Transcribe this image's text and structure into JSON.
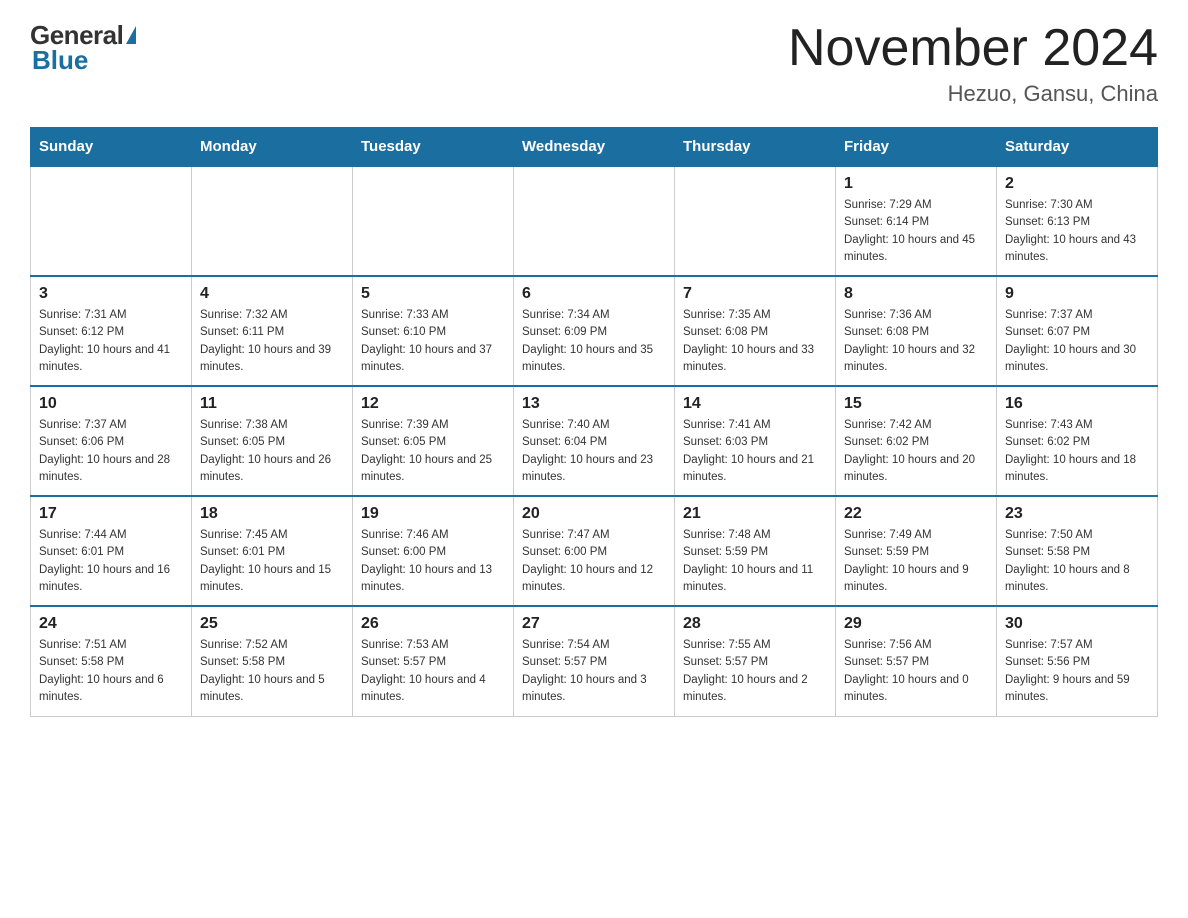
{
  "header": {
    "logo_general": "General",
    "logo_blue": "Blue",
    "month_title": "November 2024",
    "location": "Hezuo, Gansu, China"
  },
  "weekdays": [
    "Sunday",
    "Monday",
    "Tuesday",
    "Wednesday",
    "Thursday",
    "Friday",
    "Saturday"
  ],
  "weeks": [
    [
      {
        "day": "",
        "info": ""
      },
      {
        "day": "",
        "info": ""
      },
      {
        "day": "",
        "info": ""
      },
      {
        "day": "",
        "info": ""
      },
      {
        "day": "",
        "info": ""
      },
      {
        "day": "1",
        "info": "Sunrise: 7:29 AM\nSunset: 6:14 PM\nDaylight: 10 hours and 45 minutes."
      },
      {
        "day": "2",
        "info": "Sunrise: 7:30 AM\nSunset: 6:13 PM\nDaylight: 10 hours and 43 minutes."
      }
    ],
    [
      {
        "day": "3",
        "info": "Sunrise: 7:31 AM\nSunset: 6:12 PM\nDaylight: 10 hours and 41 minutes."
      },
      {
        "day": "4",
        "info": "Sunrise: 7:32 AM\nSunset: 6:11 PM\nDaylight: 10 hours and 39 minutes."
      },
      {
        "day": "5",
        "info": "Sunrise: 7:33 AM\nSunset: 6:10 PM\nDaylight: 10 hours and 37 minutes."
      },
      {
        "day": "6",
        "info": "Sunrise: 7:34 AM\nSunset: 6:09 PM\nDaylight: 10 hours and 35 minutes."
      },
      {
        "day": "7",
        "info": "Sunrise: 7:35 AM\nSunset: 6:08 PM\nDaylight: 10 hours and 33 minutes."
      },
      {
        "day": "8",
        "info": "Sunrise: 7:36 AM\nSunset: 6:08 PM\nDaylight: 10 hours and 32 minutes."
      },
      {
        "day": "9",
        "info": "Sunrise: 7:37 AM\nSunset: 6:07 PM\nDaylight: 10 hours and 30 minutes."
      }
    ],
    [
      {
        "day": "10",
        "info": "Sunrise: 7:37 AM\nSunset: 6:06 PM\nDaylight: 10 hours and 28 minutes."
      },
      {
        "day": "11",
        "info": "Sunrise: 7:38 AM\nSunset: 6:05 PM\nDaylight: 10 hours and 26 minutes."
      },
      {
        "day": "12",
        "info": "Sunrise: 7:39 AM\nSunset: 6:05 PM\nDaylight: 10 hours and 25 minutes."
      },
      {
        "day": "13",
        "info": "Sunrise: 7:40 AM\nSunset: 6:04 PM\nDaylight: 10 hours and 23 minutes."
      },
      {
        "day": "14",
        "info": "Sunrise: 7:41 AM\nSunset: 6:03 PM\nDaylight: 10 hours and 21 minutes."
      },
      {
        "day": "15",
        "info": "Sunrise: 7:42 AM\nSunset: 6:02 PM\nDaylight: 10 hours and 20 minutes."
      },
      {
        "day": "16",
        "info": "Sunrise: 7:43 AM\nSunset: 6:02 PM\nDaylight: 10 hours and 18 minutes."
      }
    ],
    [
      {
        "day": "17",
        "info": "Sunrise: 7:44 AM\nSunset: 6:01 PM\nDaylight: 10 hours and 16 minutes."
      },
      {
        "day": "18",
        "info": "Sunrise: 7:45 AM\nSunset: 6:01 PM\nDaylight: 10 hours and 15 minutes."
      },
      {
        "day": "19",
        "info": "Sunrise: 7:46 AM\nSunset: 6:00 PM\nDaylight: 10 hours and 13 minutes."
      },
      {
        "day": "20",
        "info": "Sunrise: 7:47 AM\nSunset: 6:00 PM\nDaylight: 10 hours and 12 minutes."
      },
      {
        "day": "21",
        "info": "Sunrise: 7:48 AM\nSunset: 5:59 PM\nDaylight: 10 hours and 11 minutes."
      },
      {
        "day": "22",
        "info": "Sunrise: 7:49 AM\nSunset: 5:59 PM\nDaylight: 10 hours and 9 minutes."
      },
      {
        "day": "23",
        "info": "Sunrise: 7:50 AM\nSunset: 5:58 PM\nDaylight: 10 hours and 8 minutes."
      }
    ],
    [
      {
        "day": "24",
        "info": "Sunrise: 7:51 AM\nSunset: 5:58 PM\nDaylight: 10 hours and 6 minutes."
      },
      {
        "day": "25",
        "info": "Sunrise: 7:52 AM\nSunset: 5:58 PM\nDaylight: 10 hours and 5 minutes."
      },
      {
        "day": "26",
        "info": "Sunrise: 7:53 AM\nSunset: 5:57 PM\nDaylight: 10 hours and 4 minutes."
      },
      {
        "day": "27",
        "info": "Sunrise: 7:54 AM\nSunset: 5:57 PM\nDaylight: 10 hours and 3 minutes."
      },
      {
        "day": "28",
        "info": "Sunrise: 7:55 AM\nSunset: 5:57 PM\nDaylight: 10 hours and 2 minutes."
      },
      {
        "day": "29",
        "info": "Sunrise: 7:56 AM\nSunset: 5:57 PM\nDaylight: 10 hours and 0 minutes."
      },
      {
        "day": "30",
        "info": "Sunrise: 7:57 AM\nSunset: 5:56 PM\nDaylight: 9 hours and 59 minutes."
      }
    ]
  ]
}
